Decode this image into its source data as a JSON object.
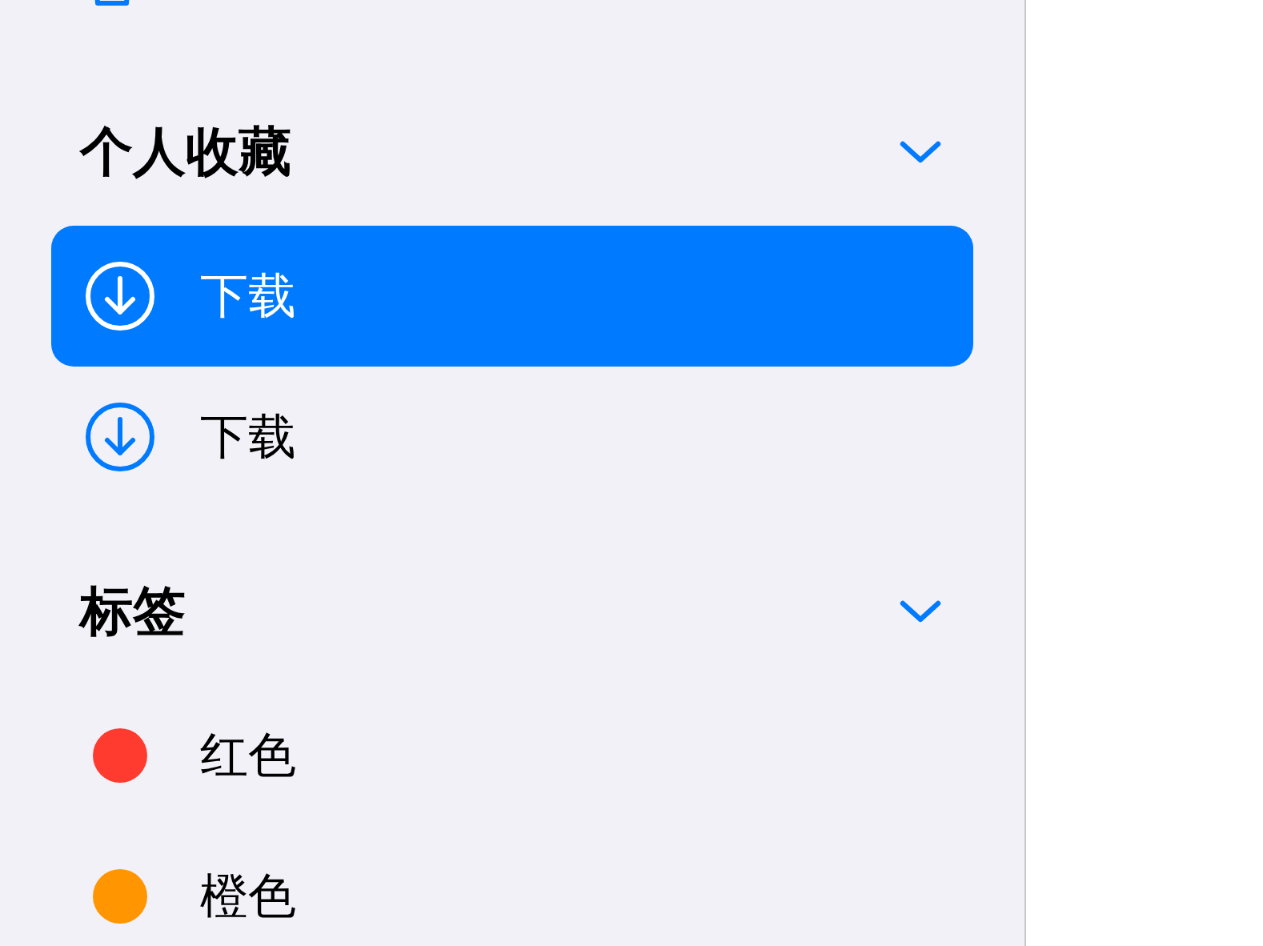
{
  "sidebar": {
    "sections": [
      {
        "title": "个人收藏",
        "expanded": true,
        "items": [
          {
            "kind": "download",
            "label": "下载",
            "selected": true
          },
          {
            "kind": "download",
            "label": "下载",
            "selected": false
          }
        ]
      },
      {
        "title": "标签",
        "expanded": true,
        "items": [
          {
            "kind": "tag",
            "label": "红色",
            "color": "#ff3b30",
            "selected": false
          },
          {
            "kind": "tag",
            "label": "橙色",
            "color": "#ff9500",
            "selected": false
          }
        ]
      }
    ]
  }
}
